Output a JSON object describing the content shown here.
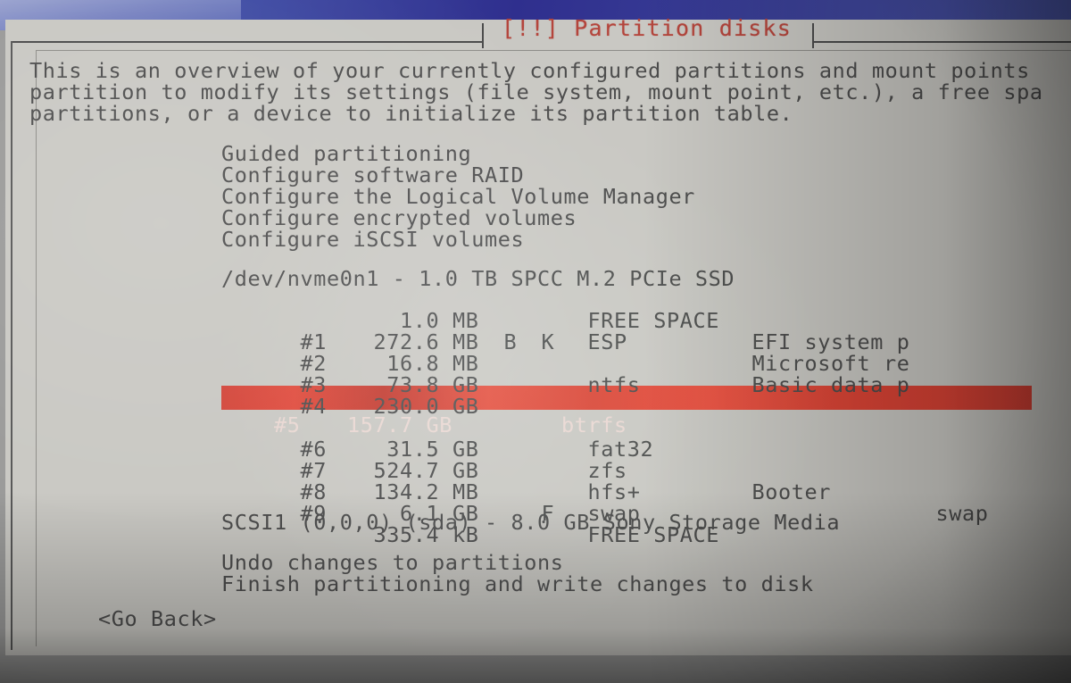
{
  "window": {
    "title": "[!!] Partition disks",
    "title_color": "#b4453c",
    "surface_color": "#c9c8c3",
    "desktop_color": "#2f2f8e",
    "text_color": "#4d4d4d",
    "highlight_color": "#d94436",
    "highlight_text_color": "#e9d7d2"
  },
  "intro": {
    "lines": [
      "This is an overview of your currently configured partitions and mount points",
      "partition to modify its settings (file system, mount point, etc.), a free spa",
      "partitions, or a device to initialize its partition table."
    ]
  },
  "menu": {
    "items": [
      "Guided partitioning",
      "Configure software RAID",
      "Configure the Logical Volume Manager",
      "Configure encrypted volumes",
      "Configure iSCSI volumes"
    ]
  },
  "disks": [
    {
      "device_line": "/dev/nvme0n1 - 1.0 TB SPCC M.2 PCIe SSD",
      "rows": [
        {
          "num": "",
          "size": "1.0 MB",
          "flag1": "",
          "flag2": "",
          "type": "FREE SPACE",
          "label": "",
          "mount": "",
          "selected": false
        },
        {
          "num": "#1",
          "size": "272.6 MB",
          "flag1": "B",
          "flag2": "K",
          "type": "ESP",
          "label": "EFI system p",
          "mount": "",
          "selected": false
        },
        {
          "num": "#2",
          "size": "16.8 MB",
          "flag1": "",
          "flag2": "",
          "type": "",
          "label": "Microsoft re",
          "mount": "",
          "selected": false
        },
        {
          "num": "#3",
          "size": "73.8 GB",
          "flag1": "",
          "flag2": "",
          "type": "ntfs",
          "label": "Basic data p",
          "mount": "",
          "selected": false
        },
        {
          "num": "#4",
          "size": "230.0 GB",
          "flag1": "",
          "flag2": "",
          "type": "",
          "label": "",
          "mount": "",
          "selected": false
        },
        {
          "num": "#5",
          "size": "157.7 GB",
          "flag1": "",
          "flag2": "",
          "type": "btrfs",
          "label": "",
          "mount": "",
          "selected": true
        },
        {
          "num": "#6",
          "size": "31.5 GB",
          "flag1": "",
          "flag2": "",
          "type": "fat32",
          "label": "",
          "mount": "",
          "selected": false
        },
        {
          "num": "#7",
          "size": "524.7 GB",
          "flag1": "",
          "flag2": "",
          "type": "zfs",
          "label": "",
          "mount": "",
          "selected": false
        },
        {
          "num": "#8",
          "size": "134.2 MB",
          "flag1": "",
          "flag2": "",
          "type": "hfs+",
          "label": "Booter",
          "mount": "",
          "selected": false
        },
        {
          "num": "#9",
          "size": "6.1 GB",
          "flag1": "",
          "flag2": "F",
          "type": "swap",
          "label": "",
          "mount": "swap",
          "selected": false
        },
        {
          "num": "",
          "size": "335.4 kB",
          "flag1": "",
          "flag2": "",
          "type": "FREE SPACE",
          "label": "",
          "mount": "",
          "selected": false
        }
      ]
    },
    {
      "device_line": "SCSI1 (0,0,0) (sda) - 8.0 GB Sony Storage Media",
      "rows": []
    }
  ],
  "actions": [
    "Undo changes to partitions",
    "Finish partitioning and write changes to disk"
  ],
  "buttons": {
    "go_back": "<Go Back>"
  }
}
